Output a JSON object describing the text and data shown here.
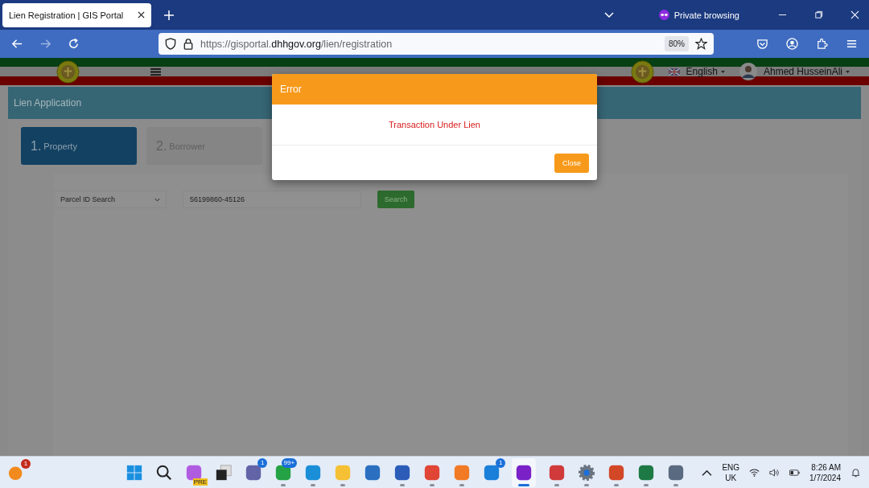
{
  "browser": {
    "tab_title": "Lien Registration | GIS Portal",
    "private_label": "Private browsing",
    "url_prefix": "https://gisportal.",
    "url_domain": "dhhgov.org",
    "url_path": "/lien/registration",
    "zoom": "80%"
  },
  "header": {
    "language": "English",
    "user": "Ahmed HusseinAli"
  },
  "panel": {
    "title": "Lien Application"
  },
  "steps": [
    {
      "number": "1.",
      "label": "Property",
      "selected": true
    },
    {
      "number": "2.",
      "label": "Borrower",
      "selected": false
    }
  ],
  "search": {
    "type": "Parcel ID Search",
    "value": "56199860-45126",
    "button": "Search"
  },
  "modal": {
    "title": "Error",
    "message": "Transaction Under Lien",
    "button": "Close"
  },
  "taskbar": {
    "notification_badge": "1",
    "apps": [
      {
        "kind": "start",
        "running": false,
        "selected": false
      },
      {
        "kind": "search",
        "running": false,
        "selected": false
      },
      {
        "kind": "copilot",
        "badge_text": "PRE",
        "running": false,
        "selected": false
      },
      {
        "kind": "taskview",
        "running": false,
        "selected": false
      },
      {
        "kind": "teams",
        "badge": "1",
        "running": false,
        "selected": false
      },
      {
        "kind": "whatsapp",
        "badge": "99+",
        "running": true,
        "selected": false
      },
      {
        "kind": "edge",
        "running": true,
        "selected": false
      },
      {
        "kind": "folder",
        "running": true,
        "selected": false
      },
      {
        "kind": "store",
        "running": false,
        "selected": false
      },
      {
        "kind": "word",
        "running": true,
        "selected": false
      },
      {
        "kind": "chrome",
        "running": true,
        "selected": false
      },
      {
        "kind": "firefox",
        "running": true,
        "selected": false
      },
      {
        "kind": "mail",
        "badge": "1",
        "running": false,
        "selected": false
      },
      {
        "kind": "private",
        "running": true,
        "selected": true
      },
      {
        "kind": "snip",
        "running": true,
        "selected": false
      },
      {
        "kind": "settings",
        "running": true,
        "selected": false
      },
      {
        "kind": "powerpoint",
        "running": true,
        "selected": false
      },
      {
        "kind": "excel",
        "running": true,
        "selected": false
      },
      {
        "kind": "calculator",
        "running": true,
        "selected": false
      }
    ],
    "lang_top": "ENG",
    "lang_bottom": "UK",
    "time": "8:26 AM",
    "date": "1/7/2024"
  }
}
